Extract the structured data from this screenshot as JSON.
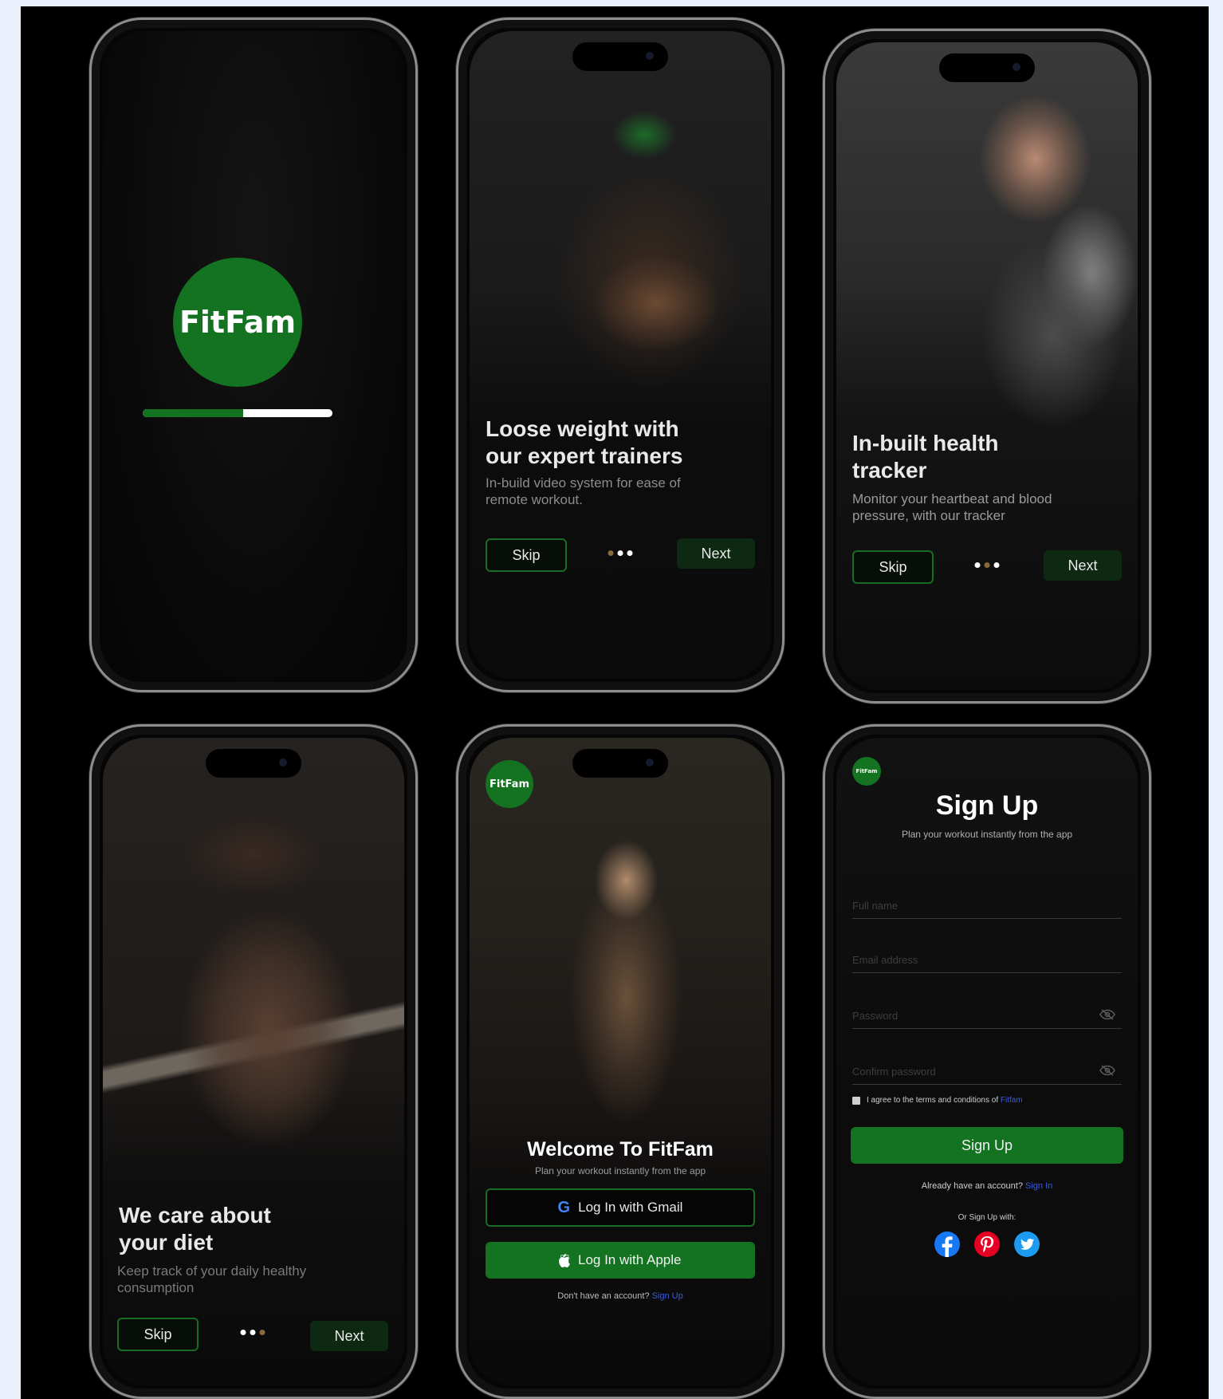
{
  "splash": {
    "logo_text": "FitFam",
    "progress": 0.53,
    "colors": {
      "accent": "#137321",
      "track": "#ffffff"
    }
  },
  "onboard1": {
    "title_line1": "Loose weight with",
    "title_line2": "our expert trainers",
    "subtitle_line1": "In-build video system for ease of",
    "subtitle_line2": "remote workout.",
    "skip": "Skip",
    "next": "Next",
    "active_dot": 0
  },
  "onboard2": {
    "title_line1": "In-built health",
    "title_line2": "tracker",
    "subtitle_line1": "Monitor your heartbeat and blood",
    "subtitle_line2": "pressure, with our tracker",
    "skip": "Skip",
    "next": "Next",
    "active_dot": 1
  },
  "onboard3": {
    "title_line1": "We care about",
    "title_line2": "your diet",
    "subtitle_line1": "Keep track of your daily healthy",
    "subtitle_line2": "consumption",
    "skip": "Skip",
    "next": "Next",
    "active_dot": 2
  },
  "welcome": {
    "logo_text": "FitFam",
    "title": "Welcome To FitFam",
    "subtitle": "Plan your  workout instantly from the app",
    "gmail_button": "Log In with Gmail",
    "apple_button": "Log In with Apple",
    "no_account": "Don't have an account?",
    "signup_link": "Sign Up"
  },
  "signup": {
    "logo_text": "FitFam",
    "title": "Sign Up",
    "subtitle": "Plan your  workout instantly from the app",
    "full_name_placeholder": "Full name",
    "email_placeholder": "Email address",
    "password_placeholder": "Password",
    "confirm_placeholder": "Confirm password",
    "terms_text": "I agree to the terms and conditions of",
    "terms_link": "Fitfam",
    "signup_button": "Sign Up",
    "have_account": "Already have an account?",
    "signin_link": "Sign In",
    "or_signup": "Or Sign Up with:",
    "socials": [
      "facebook-icon",
      "pinterest-icon",
      "twitter-icon"
    ]
  }
}
